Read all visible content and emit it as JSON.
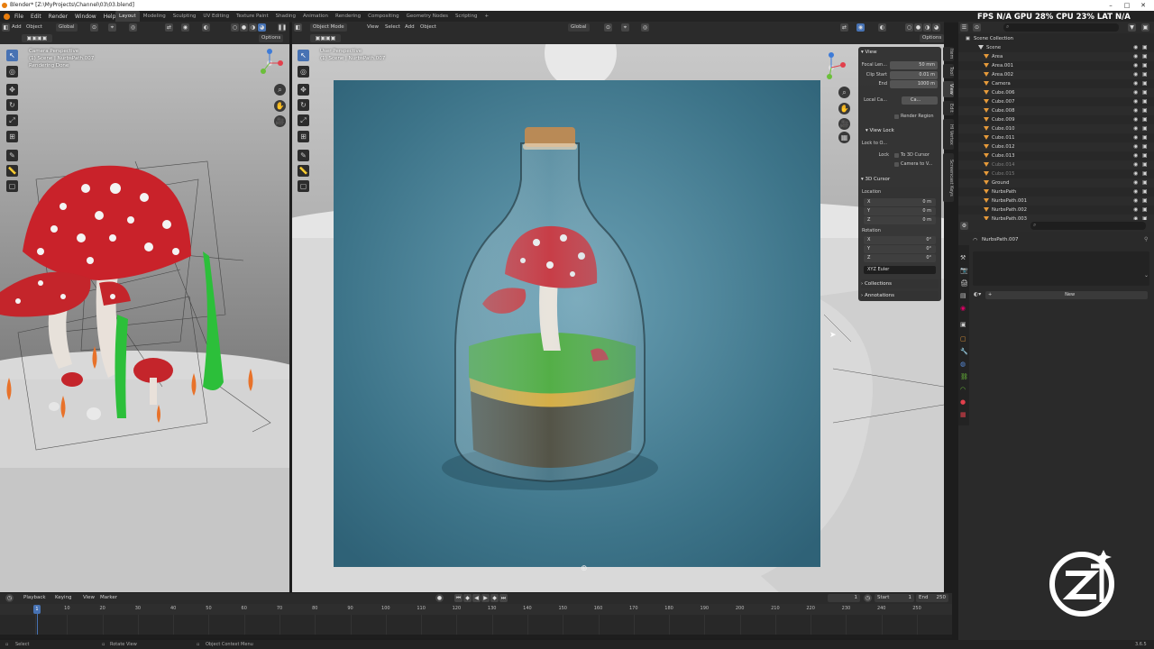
{
  "window": {
    "title": "Blender* [Z:\\MyProjects\\Channel\\03\\03.blend]"
  },
  "menubar": {
    "menus": [
      "File",
      "Edit",
      "Render",
      "Window",
      "Help"
    ],
    "workspaces": [
      "Layout",
      "Modeling",
      "Sculpting",
      "UV Editing",
      "Texture Paint",
      "Shading",
      "Animation",
      "Rendering",
      "Compositing",
      "Geometry Nodes",
      "Scripting"
    ],
    "add_tab": "+",
    "stats": "FPS N/A GPU 28% CPU 23% LAT N/A"
  },
  "viewport_left": {
    "header": {
      "menus": [
        "View",
        "Add",
        "Object"
      ],
      "orientation": "Global",
      "options": "Options"
    },
    "overlay": {
      "line1": "Camera Perspective",
      "line2": "(1) Scene | NurbsPath.007",
      "line3": "Rendering Done"
    }
  },
  "viewport_right": {
    "header": {
      "mode": "Object Mode",
      "menus": [
        "View",
        "Select",
        "Add",
        "Object"
      ],
      "orientation": "Global",
      "options": "Options"
    },
    "overlay": {
      "line1": "User Perspective",
      "line2": "(1) Scene | NurbsPath.007"
    }
  },
  "sidebar_tabs": [
    "Item",
    "Tool",
    "View",
    "Edit",
    "HI Vertex",
    "Screencast Keys"
  ],
  "npanel": {
    "view_title": "View",
    "focal_label": "Focal Len...",
    "focal_value": "50 mm",
    "clip_start_label": "Clip Start",
    "clip_start_value": "0.01 m",
    "end_label": "End",
    "end_value": "1000 m",
    "local_camera_label": "Local Ca...",
    "local_camera_value": "Ca...",
    "render_region": "Render Region",
    "view_lock_title": "View Lock",
    "lock_to_object_label": "Lock to O...",
    "lock_label": "Lock",
    "to_3d_cursor": "To 3D Cursor",
    "camera_to_view": "Camera to V...",
    "cursor_title": "3D Cursor",
    "location_label": "Location",
    "loc": [
      {
        "axis": "X",
        "value": "0 m"
      },
      {
        "axis": "Y",
        "value": "0 m"
      },
      {
        "axis": "Z",
        "value": "0 m"
      }
    ],
    "rotation_label": "Rotation",
    "rot": [
      {
        "axis": "X",
        "value": "0°"
      },
      {
        "axis": "Y",
        "value": "0°"
      },
      {
        "axis": "Z",
        "value": "0°"
      }
    ],
    "rot_mode": "XYZ Euler",
    "collections": "Collections",
    "annotations": "Annotations"
  },
  "outliner": {
    "title": "Scene Collection",
    "items": [
      {
        "name": "Scene",
        "muted": false
      },
      {
        "name": "Area",
        "muted": false
      },
      {
        "name": "Area.001",
        "muted": false
      },
      {
        "name": "Area.002",
        "muted": false
      },
      {
        "name": "Camera",
        "muted": false
      },
      {
        "name": "Cube.006",
        "muted": false
      },
      {
        "name": "Cube.007",
        "muted": false
      },
      {
        "name": "Cube.008",
        "muted": false
      },
      {
        "name": "Cube.009",
        "muted": false
      },
      {
        "name": "Cube.010",
        "muted": false
      },
      {
        "name": "Cube.011",
        "muted": false
      },
      {
        "name": "Cube.012",
        "muted": false
      },
      {
        "name": "Cube.013",
        "muted": false
      },
      {
        "name": "Cube.014",
        "muted": true
      },
      {
        "name": "Cube.015",
        "muted": true
      },
      {
        "name": "Ground",
        "muted": false
      },
      {
        "name": "NurbsPath",
        "muted": false
      },
      {
        "name": "NurbsPath.001",
        "muted": false
      },
      {
        "name": "NurbsPath.002",
        "muted": false
      },
      {
        "name": "NurbsPath.003",
        "muted": false
      }
    ]
  },
  "properties": {
    "object_name": "NurbsPath.007",
    "new_button": "New"
  },
  "timeline": {
    "menus": [
      "Playback",
      "Keying",
      "View",
      "Marker"
    ],
    "current_frame": "1",
    "start_label": "Start",
    "start_value": "1",
    "end_label": "End",
    "end_value": "250",
    "ticks": [
      "1",
      "10",
      "20",
      "30",
      "40",
      "50",
      "60",
      "70",
      "80",
      "90",
      "100",
      "110",
      "120",
      "130",
      "140",
      "150",
      "160",
      "170",
      "180",
      "190",
      "200",
      "210",
      "220",
      "230",
      "240",
      "250"
    ]
  },
  "statusbar": {
    "select": "Select",
    "rotate": "Rotate View",
    "context": "Object Context Menu",
    "version": "3.6.5"
  },
  "colors": {
    "accent": "#4772b3",
    "panel": "#282828",
    "header": "#2b2b2b",
    "playhead": "#4772b3"
  }
}
